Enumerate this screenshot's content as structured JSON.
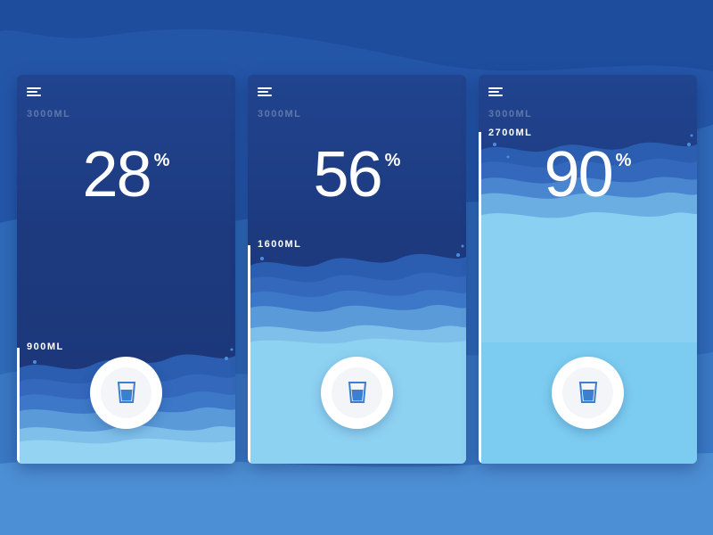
{
  "colors": {
    "background": "#2a5fb0",
    "card_top": "#21448f",
    "water_light": "#8ed4f2",
    "water_mid": "#5aa8e0",
    "water_dark": "#2f66bd",
    "button": "#ffffff",
    "glass": "#3b7fd0"
  },
  "cards": [
    {
      "capacity": "3000ML",
      "percent": "28",
      "percent_symbol": "%",
      "level_label": "900ML",
      "fill_fraction": 0.28
    },
    {
      "capacity": "3000ML",
      "percent": "56",
      "percent_symbol": "%",
      "level_label": "1600ML",
      "fill_fraction": 0.56
    },
    {
      "capacity": "3000ML",
      "percent": "90",
      "percent_symbol": "%",
      "level_label": "2700ML",
      "fill_fraction": 0.9
    }
  ],
  "icons": {
    "menu": "menu-icon",
    "glass": "water-glass-icon"
  }
}
